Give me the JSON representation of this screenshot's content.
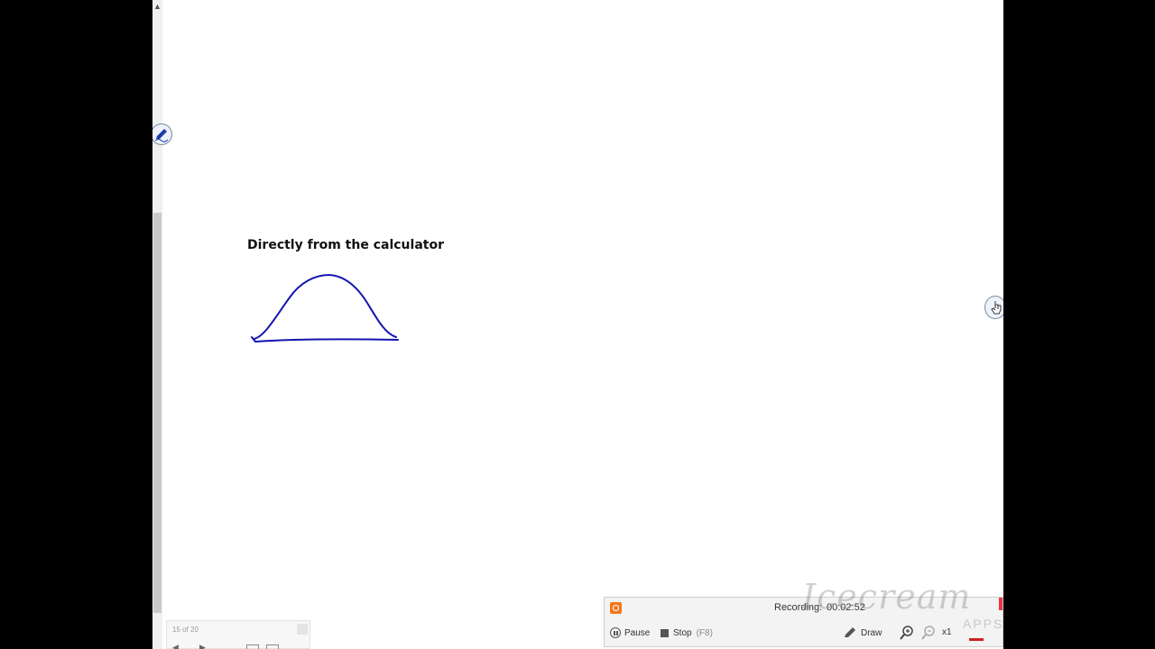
{
  "slide": {
    "title": "Directly from the calculator",
    "ink_color": "#1515b0"
  },
  "scrollbar": {
    "up_arrow_glyph": "▲"
  },
  "navigator": {
    "page_counter": "15 of 20",
    "prev_glyph": "◀",
    "next_glyph": "▶"
  },
  "recorder": {
    "label": "Recording:",
    "time": "00:02:52",
    "pause_label": "Pause",
    "stop_label": "Stop",
    "stop_shortcut": "(F8)",
    "draw_label": "Draw",
    "zoom_level": "x1",
    "accent_color": "#f0781e"
  },
  "watermark": {
    "brand": "Icecream",
    "sub": "APPS"
  },
  "icons": [
    "pen-icon",
    "hand-cursor-icon",
    "pencil-icon",
    "zoom-in-icon",
    "zoom-out-icon"
  ]
}
